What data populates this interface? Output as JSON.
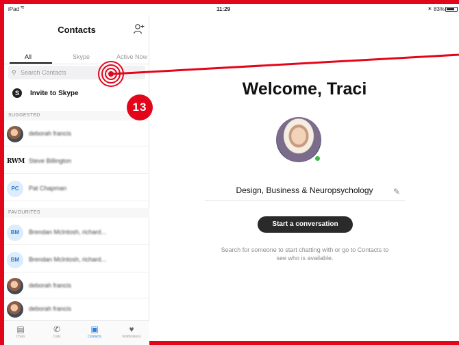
{
  "status_bar": {
    "device": "iPad",
    "time": "11:29",
    "battery": "83%"
  },
  "sidebar": {
    "title": "Contacts",
    "tabs": [
      {
        "label": "All",
        "active": true
      },
      {
        "label": "Skype",
        "active": false
      },
      {
        "label": "Active Now",
        "active": false
      }
    ],
    "search_placeholder": "Search Contacts",
    "invite_label": "Invite to Skype",
    "sections": {
      "suggested": "SUGGESTED",
      "favourites": "FAVOURITES"
    },
    "suggested": [
      {
        "avatar": "photo",
        "name": "deborah francis"
      },
      {
        "avatar": "RWM",
        "name": "Steve Billington"
      },
      {
        "avatar": "PC",
        "name": "Pat Chapman"
      }
    ],
    "favourites": [
      {
        "avatar": "BM",
        "name": "Brendan McIntosh, richard..."
      },
      {
        "avatar": "BM",
        "name": "Brendan McIntosh, richard..."
      },
      {
        "avatar": "photo",
        "name": "deborah francis"
      },
      {
        "avatar": "photo",
        "name": "deborah francis"
      }
    ],
    "tabbar": [
      {
        "label": "Chats",
        "icon": "chat-icon"
      },
      {
        "label": "Calls",
        "icon": "phone-icon"
      },
      {
        "label": "Contacts",
        "icon": "contacts-icon",
        "active": true
      },
      {
        "label": "Notifications",
        "icon": "bell-icon"
      }
    ]
  },
  "main": {
    "welcome": "Welcome, Traci",
    "mood": "Design, Business & Neuropsychology",
    "start_button": "Start a conversation",
    "hint": "Search for someone to start chatting with or go to Contacts to see who is available."
  },
  "annotation": {
    "step": "13",
    "color": "#e3061b"
  },
  "colors": {
    "accent": "#2b7de0",
    "online": "#3cbc4b",
    "annotation": "#e3061b"
  }
}
